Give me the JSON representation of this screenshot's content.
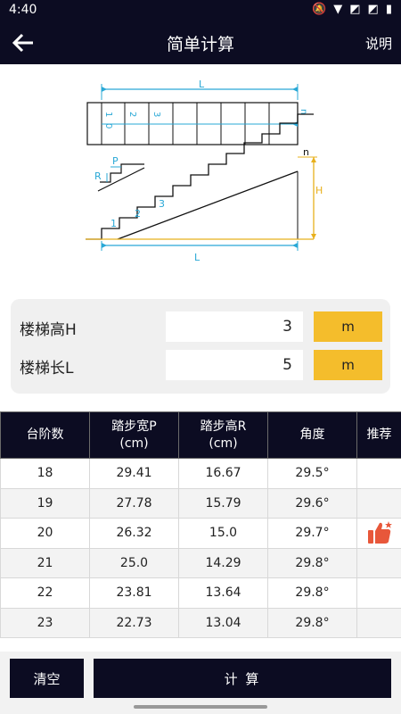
{
  "status": {
    "time": "4:40"
  },
  "appbar": {
    "title": "简单计算",
    "help": "说明"
  },
  "diagram": {
    "top_L": "L",
    "top_steps": [
      "1",
      "0",
      "2",
      "3",
      "n"
    ],
    "detail_P": "P",
    "detail_R": "R",
    "stairs_n": "n",
    "stairs_steps": [
      "1",
      "2",
      "3"
    ],
    "H": "H",
    "bottom_L": "L",
    "colors": {
      "dim": "#29a8d6",
      "height": "#e8b01c",
      "line": "#111111"
    }
  },
  "inputs": {
    "height": {
      "label": "楼梯高H",
      "value": "3",
      "unit": "m"
    },
    "length": {
      "label": "楼梯长L",
      "value": "5",
      "unit": "m"
    }
  },
  "table": {
    "headers": [
      "台阶数",
      "踏步宽P\n(cm)",
      "踏步高R\n(cm)",
      "角度",
      "推荐"
    ],
    "rows": [
      {
        "steps": "18",
        "p": "29.41",
        "r": "16.67",
        "angle": "29.5°"
      },
      {
        "steps": "19",
        "p": "27.78",
        "r": "15.79",
        "angle": "29.6°"
      },
      {
        "steps": "20",
        "p": "26.32",
        "r": "15.0",
        "angle": "29.7°",
        "recommended": true
      },
      {
        "steps": "21",
        "p": "25.0",
        "r": "14.29",
        "angle": "29.8°"
      },
      {
        "steps": "22",
        "p": "23.81",
        "r": "13.64",
        "angle": "29.8°"
      },
      {
        "steps": "23",
        "p": "22.73",
        "r": "13.04",
        "angle": "29.8°"
      }
    ]
  },
  "buttons": {
    "clear": "清空",
    "calc": "计 算"
  },
  "colors": {
    "bar": "#0c0c22",
    "accent": "#f4bd2c",
    "thumb": "#e8573a"
  }
}
